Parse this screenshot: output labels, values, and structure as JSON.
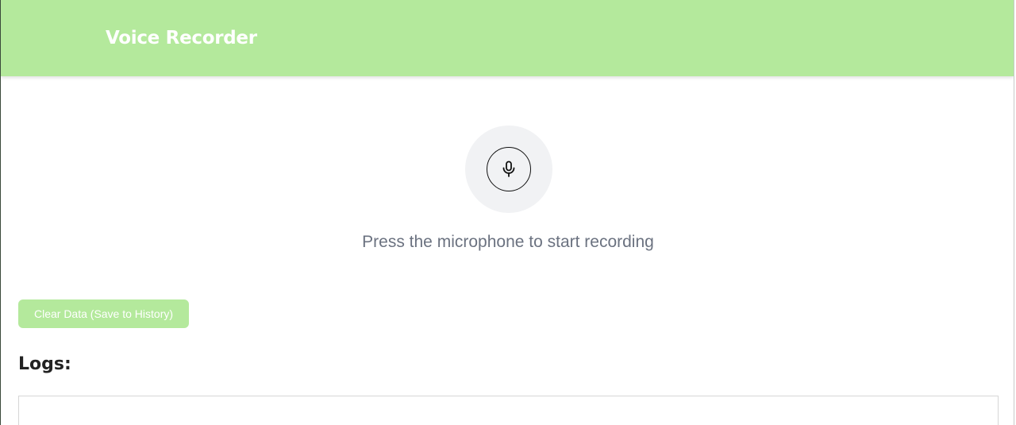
{
  "header": {
    "title": "Voice Recorder",
    "background_color": "#b4e99c"
  },
  "recorder": {
    "mic_icon": "microphone-icon",
    "status_text": "Press the microphone to start recording"
  },
  "actions": {
    "clear_label": "Clear Data (Save to History)",
    "accent_color": "#b4e99c"
  },
  "logs": {
    "heading": "Logs:",
    "entries": []
  }
}
